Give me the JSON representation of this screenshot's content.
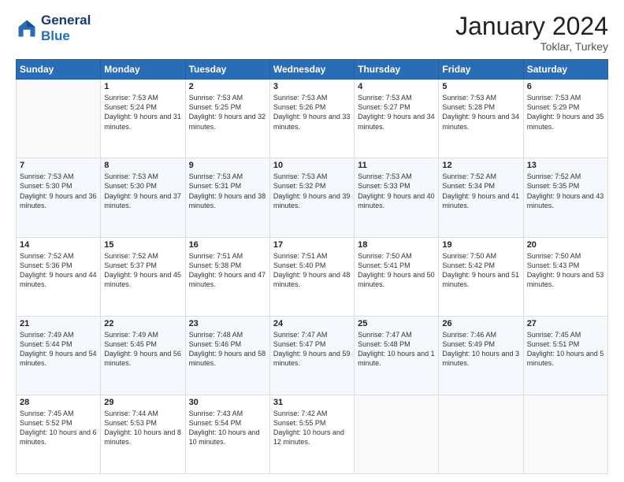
{
  "logo": {
    "line1": "General",
    "line2": "Blue"
  },
  "header": {
    "title": "January 2024",
    "subtitle": "Toklar, Turkey"
  },
  "weekdays": [
    "Sunday",
    "Monday",
    "Tuesday",
    "Wednesday",
    "Thursday",
    "Friday",
    "Saturday"
  ],
  "weeks": [
    [
      {
        "day": "",
        "sunrise": "",
        "sunset": "",
        "daylight": ""
      },
      {
        "day": "1",
        "sunrise": "Sunrise: 7:53 AM",
        "sunset": "Sunset: 5:24 PM",
        "daylight": "Daylight: 9 hours and 31 minutes."
      },
      {
        "day": "2",
        "sunrise": "Sunrise: 7:53 AM",
        "sunset": "Sunset: 5:25 PM",
        "daylight": "Daylight: 9 hours and 32 minutes."
      },
      {
        "day": "3",
        "sunrise": "Sunrise: 7:53 AM",
        "sunset": "Sunset: 5:26 PM",
        "daylight": "Daylight: 9 hours and 33 minutes."
      },
      {
        "day": "4",
        "sunrise": "Sunrise: 7:53 AM",
        "sunset": "Sunset: 5:27 PM",
        "daylight": "Daylight: 9 hours and 34 minutes."
      },
      {
        "day": "5",
        "sunrise": "Sunrise: 7:53 AM",
        "sunset": "Sunset: 5:28 PM",
        "daylight": "Daylight: 9 hours and 34 minutes."
      },
      {
        "day": "6",
        "sunrise": "Sunrise: 7:53 AM",
        "sunset": "Sunset: 5:29 PM",
        "daylight": "Daylight: 9 hours and 35 minutes."
      }
    ],
    [
      {
        "day": "7",
        "sunrise": "Sunrise: 7:53 AM",
        "sunset": "Sunset: 5:30 PM",
        "daylight": "Daylight: 9 hours and 36 minutes."
      },
      {
        "day": "8",
        "sunrise": "Sunrise: 7:53 AM",
        "sunset": "Sunset: 5:30 PM",
        "daylight": "Daylight: 9 hours and 37 minutes."
      },
      {
        "day": "9",
        "sunrise": "Sunrise: 7:53 AM",
        "sunset": "Sunset: 5:31 PM",
        "daylight": "Daylight: 9 hours and 38 minutes."
      },
      {
        "day": "10",
        "sunrise": "Sunrise: 7:53 AM",
        "sunset": "Sunset: 5:32 PM",
        "daylight": "Daylight: 9 hours and 39 minutes."
      },
      {
        "day": "11",
        "sunrise": "Sunrise: 7:53 AM",
        "sunset": "Sunset: 5:33 PM",
        "daylight": "Daylight: 9 hours and 40 minutes."
      },
      {
        "day": "12",
        "sunrise": "Sunrise: 7:52 AM",
        "sunset": "Sunset: 5:34 PM",
        "daylight": "Daylight: 9 hours and 41 minutes."
      },
      {
        "day": "13",
        "sunrise": "Sunrise: 7:52 AM",
        "sunset": "Sunset: 5:35 PM",
        "daylight": "Daylight: 9 hours and 43 minutes."
      }
    ],
    [
      {
        "day": "14",
        "sunrise": "Sunrise: 7:52 AM",
        "sunset": "Sunset: 5:36 PM",
        "daylight": "Daylight: 9 hours and 44 minutes."
      },
      {
        "day": "15",
        "sunrise": "Sunrise: 7:52 AM",
        "sunset": "Sunset: 5:37 PM",
        "daylight": "Daylight: 9 hours and 45 minutes."
      },
      {
        "day": "16",
        "sunrise": "Sunrise: 7:51 AM",
        "sunset": "Sunset: 5:38 PM",
        "daylight": "Daylight: 9 hours and 47 minutes."
      },
      {
        "day": "17",
        "sunrise": "Sunrise: 7:51 AM",
        "sunset": "Sunset: 5:40 PM",
        "daylight": "Daylight: 9 hours and 48 minutes."
      },
      {
        "day": "18",
        "sunrise": "Sunrise: 7:50 AM",
        "sunset": "Sunset: 5:41 PM",
        "daylight": "Daylight: 9 hours and 50 minutes."
      },
      {
        "day": "19",
        "sunrise": "Sunrise: 7:50 AM",
        "sunset": "Sunset: 5:42 PM",
        "daylight": "Daylight: 9 hours and 51 minutes."
      },
      {
        "day": "20",
        "sunrise": "Sunrise: 7:50 AM",
        "sunset": "Sunset: 5:43 PM",
        "daylight": "Daylight: 9 hours and 53 minutes."
      }
    ],
    [
      {
        "day": "21",
        "sunrise": "Sunrise: 7:49 AM",
        "sunset": "Sunset: 5:44 PM",
        "daylight": "Daylight: 9 hours and 54 minutes."
      },
      {
        "day": "22",
        "sunrise": "Sunrise: 7:49 AM",
        "sunset": "Sunset: 5:45 PM",
        "daylight": "Daylight: 9 hours and 56 minutes."
      },
      {
        "day": "23",
        "sunrise": "Sunrise: 7:48 AM",
        "sunset": "Sunset: 5:46 PM",
        "daylight": "Daylight: 9 hours and 58 minutes."
      },
      {
        "day": "24",
        "sunrise": "Sunrise: 7:47 AM",
        "sunset": "Sunset: 5:47 PM",
        "daylight": "Daylight: 9 hours and 59 minutes."
      },
      {
        "day": "25",
        "sunrise": "Sunrise: 7:47 AM",
        "sunset": "Sunset: 5:48 PM",
        "daylight": "Daylight: 10 hours and 1 minute."
      },
      {
        "day": "26",
        "sunrise": "Sunrise: 7:46 AM",
        "sunset": "Sunset: 5:49 PM",
        "daylight": "Daylight: 10 hours and 3 minutes."
      },
      {
        "day": "27",
        "sunrise": "Sunrise: 7:45 AM",
        "sunset": "Sunset: 5:51 PM",
        "daylight": "Daylight: 10 hours and 5 minutes."
      }
    ],
    [
      {
        "day": "28",
        "sunrise": "Sunrise: 7:45 AM",
        "sunset": "Sunset: 5:52 PM",
        "daylight": "Daylight: 10 hours and 6 minutes."
      },
      {
        "day": "29",
        "sunrise": "Sunrise: 7:44 AM",
        "sunset": "Sunset: 5:53 PM",
        "daylight": "Daylight: 10 hours and 8 minutes."
      },
      {
        "day": "30",
        "sunrise": "Sunrise: 7:43 AM",
        "sunset": "Sunset: 5:54 PM",
        "daylight": "Daylight: 10 hours and 10 minutes."
      },
      {
        "day": "31",
        "sunrise": "Sunrise: 7:42 AM",
        "sunset": "Sunset: 5:55 PM",
        "daylight": "Daylight: 10 hours and 12 minutes."
      },
      {
        "day": "",
        "sunrise": "",
        "sunset": "",
        "daylight": ""
      },
      {
        "day": "",
        "sunrise": "",
        "sunset": "",
        "daylight": ""
      },
      {
        "day": "",
        "sunrise": "",
        "sunset": "",
        "daylight": ""
      }
    ]
  ]
}
